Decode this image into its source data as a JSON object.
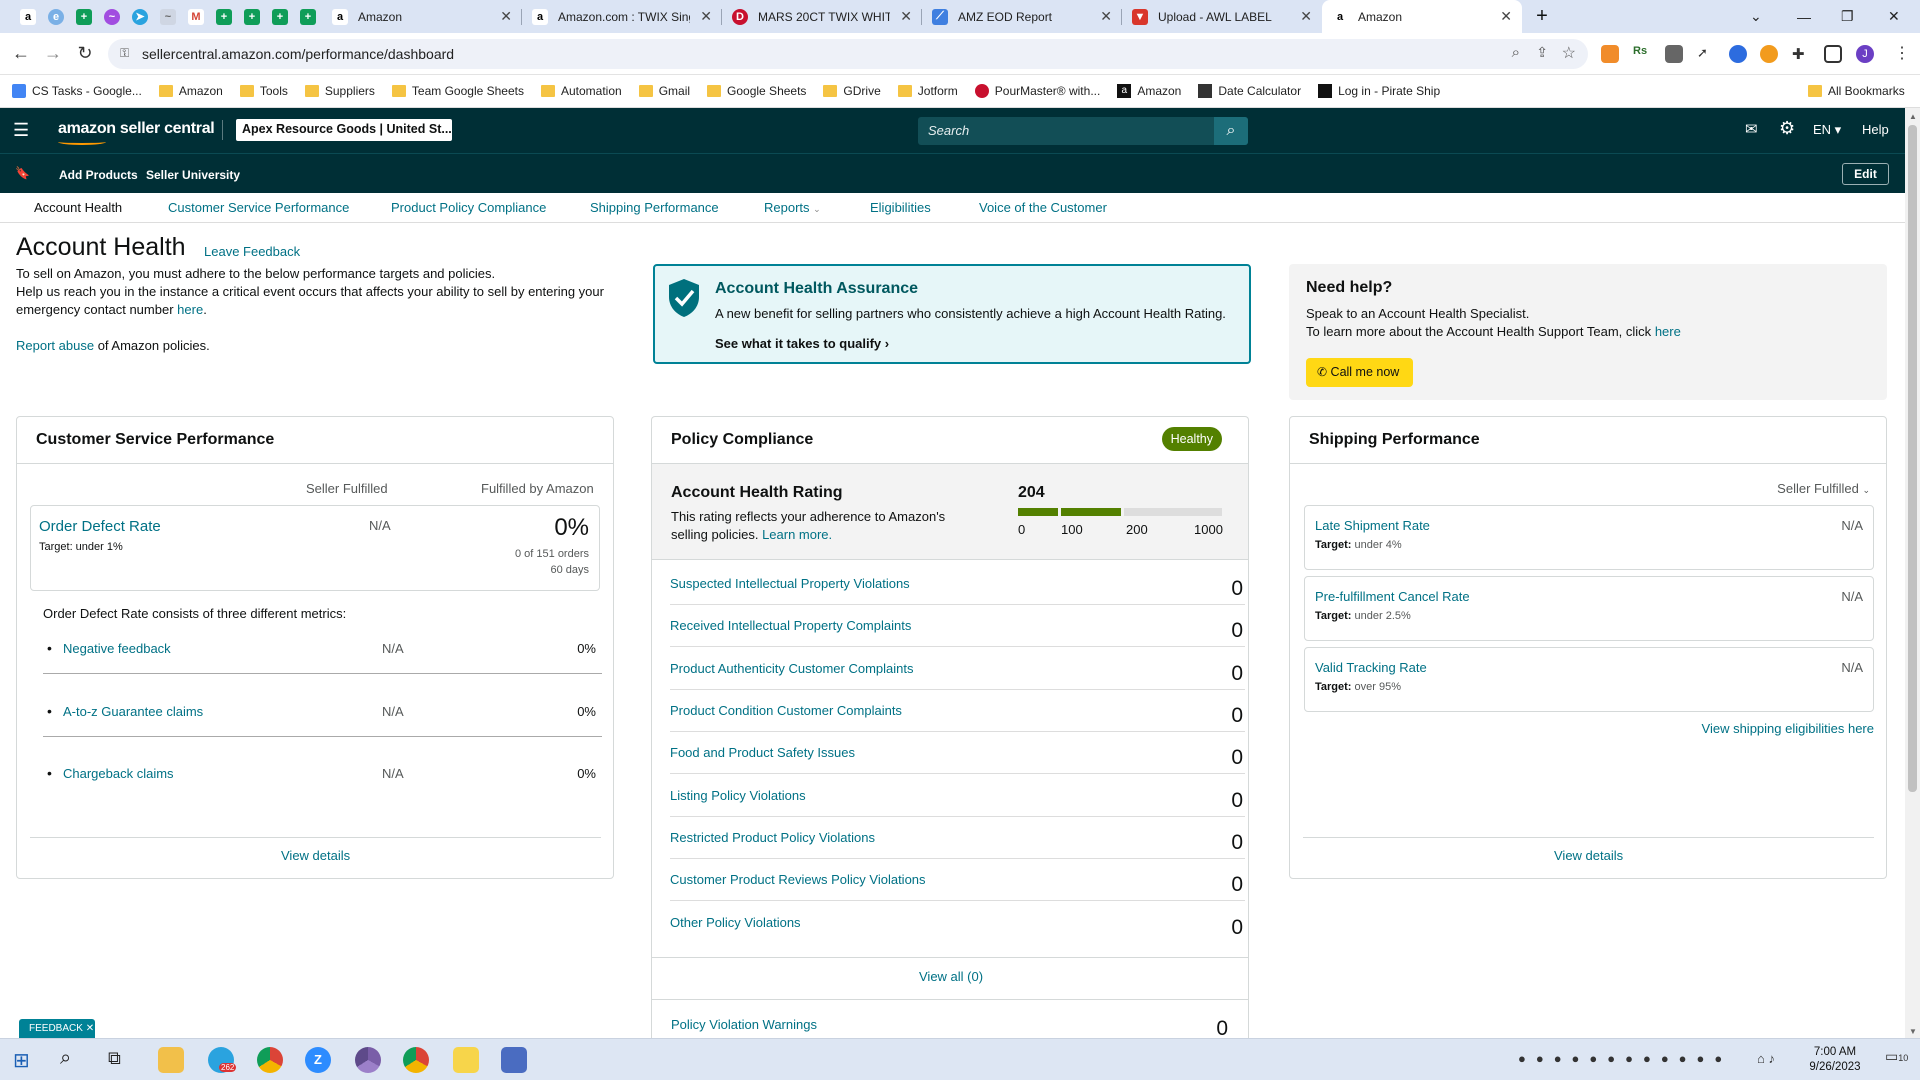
{
  "browser": {
    "tabs": [
      {
        "title": "Amazon"
      },
      {
        "title": "Amazon.com : TWIX Sing"
      },
      {
        "title": "MARS 20CT TWIX WHITE"
      },
      {
        "title": "AMZ EOD Report"
      },
      {
        "title": "Upload - AWL LABEL"
      },
      {
        "title": "Amazon"
      }
    ],
    "url": "sellercentral.amazon.com/performance/dashboard",
    "bookmarks": [
      "CS Tasks - Google...",
      "Amazon",
      "Tools",
      "Suppliers",
      "Team Google Sheets",
      "Automation",
      "Gmail",
      "Google Sheets",
      "GDrive",
      "Jotform",
      "PourMaster® with...",
      "Amazon",
      "Date Calculator",
      "Log in - Pirate Ship"
    ],
    "all_bookmarks": "All Bookmarks"
  },
  "header": {
    "logo": "amazon seller central",
    "store": "Apex Resource Goods | United St...",
    "search_placeholder": "Search",
    "lang": "EN",
    "help": "Help",
    "add_products": "Add Products",
    "seller_university": "Seller University",
    "edit": "Edit"
  },
  "subnav": [
    "Account Health",
    "Customer Service Performance",
    "Product Policy Compliance",
    "Shipping Performance",
    "Reports",
    "Eligibilities",
    "Voice of the Customer"
  ],
  "intro": {
    "title": "Account Health",
    "feedback": "Leave Feedback",
    "line1": "To sell on Amazon, you must adhere to the below performance targets and policies.",
    "line2": "Help us reach you in the instance a critical event occurs that affects your ability to sell by entering your emergency contact number",
    "here": "here",
    "report_abuse": "Report abuse",
    "report_tail": "of Amazon policies."
  },
  "assurance": {
    "title": "Account Health Assurance",
    "desc": "A new benefit for selling partners who consistently achieve a high Account Health Rating.",
    "cta": "See what it takes to qualify"
  },
  "help": {
    "title": "Need help?",
    "line1": "Speak to an Account Health Specialist.",
    "line2": "To learn more about the Account Health Support Team, click",
    "here": "here",
    "call": "Call me now"
  },
  "csp": {
    "title": "Customer Service Performance",
    "col1": "Seller Fulfilled",
    "col2": "Fulfilled by Amazon",
    "odr_label": "Order Defect Rate",
    "odr_target": "Target: under 1%",
    "odr_sf": "N/A",
    "odr_fba": "0%",
    "odr_orders": "0 of 151 orders",
    "odr_days": "60 days",
    "consists": "Order Defect Rate consists of three different metrics:",
    "metrics": [
      {
        "label": "Negative feedback",
        "sf": "N/A",
        "fba": "0%"
      },
      {
        "label": "A-to-z Guarantee claims",
        "sf": "N/A",
        "fba": "0%"
      },
      {
        "label": "Chargeback claims",
        "sf": "N/A",
        "fba": "0%"
      }
    ],
    "view_details": "View details"
  },
  "policy": {
    "title": "Policy Compliance",
    "badge": "Healthy",
    "ahr_title": "Account Health Rating",
    "ahr_desc": "This rating reflects your adherence to Amazon's selling policies.",
    "learn_more": "Learn more.",
    "score": "204",
    "scale": [
      "0",
      "100",
      "200",
      "1000"
    ],
    "rows": [
      {
        "label": "Suspected Intellectual Property Violations",
        "value": "0"
      },
      {
        "label": "Received Intellectual Property Complaints",
        "value": "0"
      },
      {
        "label": "Product Authenticity Customer Complaints",
        "value": "0"
      },
      {
        "label": "Product Condition Customer Complaints",
        "value": "0"
      },
      {
        "label": "Food and Product Safety Issues",
        "value": "0"
      },
      {
        "label": "Listing Policy Violations",
        "value": "0"
      },
      {
        "label": "Restricted Product Policy Violations",
        "value": "0"
      },
      {
        "label": "Customer Product Reviews Policy Violations",
        "value": "0"
      },
      {
        "label": "Other Policy Violations",
        "value": "0"
      }
    ],
    "view_all": "View all (0)",
    "warnings_label": "Policy Violation Warnings",
    "warnings_value": "0"
  },
  "shipping": {
    "title": "Shipping Performance",
    "filter": "Seller Fulfilled",
    "metrics": [
      {
        "label": "Late Shipment Rate",
        "target_prefix": "Target:",
        "target": "under 4%",
        "value": "N/A"
      },
      {
        "label": "Pre-fulfillment Cancel Rate",
        "target_prefix": "Target:",
        "target": "under 2.5%",
        "value": "N/A"
      },
      {
        "label": "Valid Tracking Rate",
        "target_prefix": "Target:",
        "target": "over 95%",
        "value": "N/A"
      }
    ],
    "eligibilities": "View shipping eligibilities here",
    "view_details": "View details"
  },
  "feedback_tab": "FEEDBACK",
  "taskbar": {
    "time": "7:00 AM",
    "date": "9/26/2023",
    "badge": "262",
    "notif": "10"
  },
  "colors": {
    "teal": "#002f36",
    "link": "#007185",
    "green": "#538000",
    "yellow": "#ffd814"
  }
}
